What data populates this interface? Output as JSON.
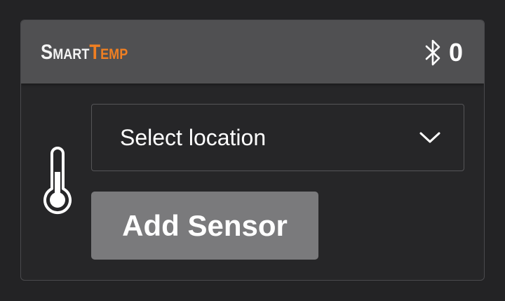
{
  "brand": {
    "part1": "Smart",
    "part2": "Temp"
  },
  "status": {
    "bluetooth_icon": "bluetooth-icon",
    "device_count": "0"
  },
  "location_select": {
    "selected": "Select location",
    "icon": "chevron-down-icon"
  },
  "sensor_icon": "thermometer-icon",
  "add_button": {
    "label": "Add Sensor"
  },
  "colors": {
    "page_bg": "#232325",
    "header_bg": "#505052",
    "brand_accent": "#f07f22",
    "button_bg": "#7a7a7c"
  }
}
